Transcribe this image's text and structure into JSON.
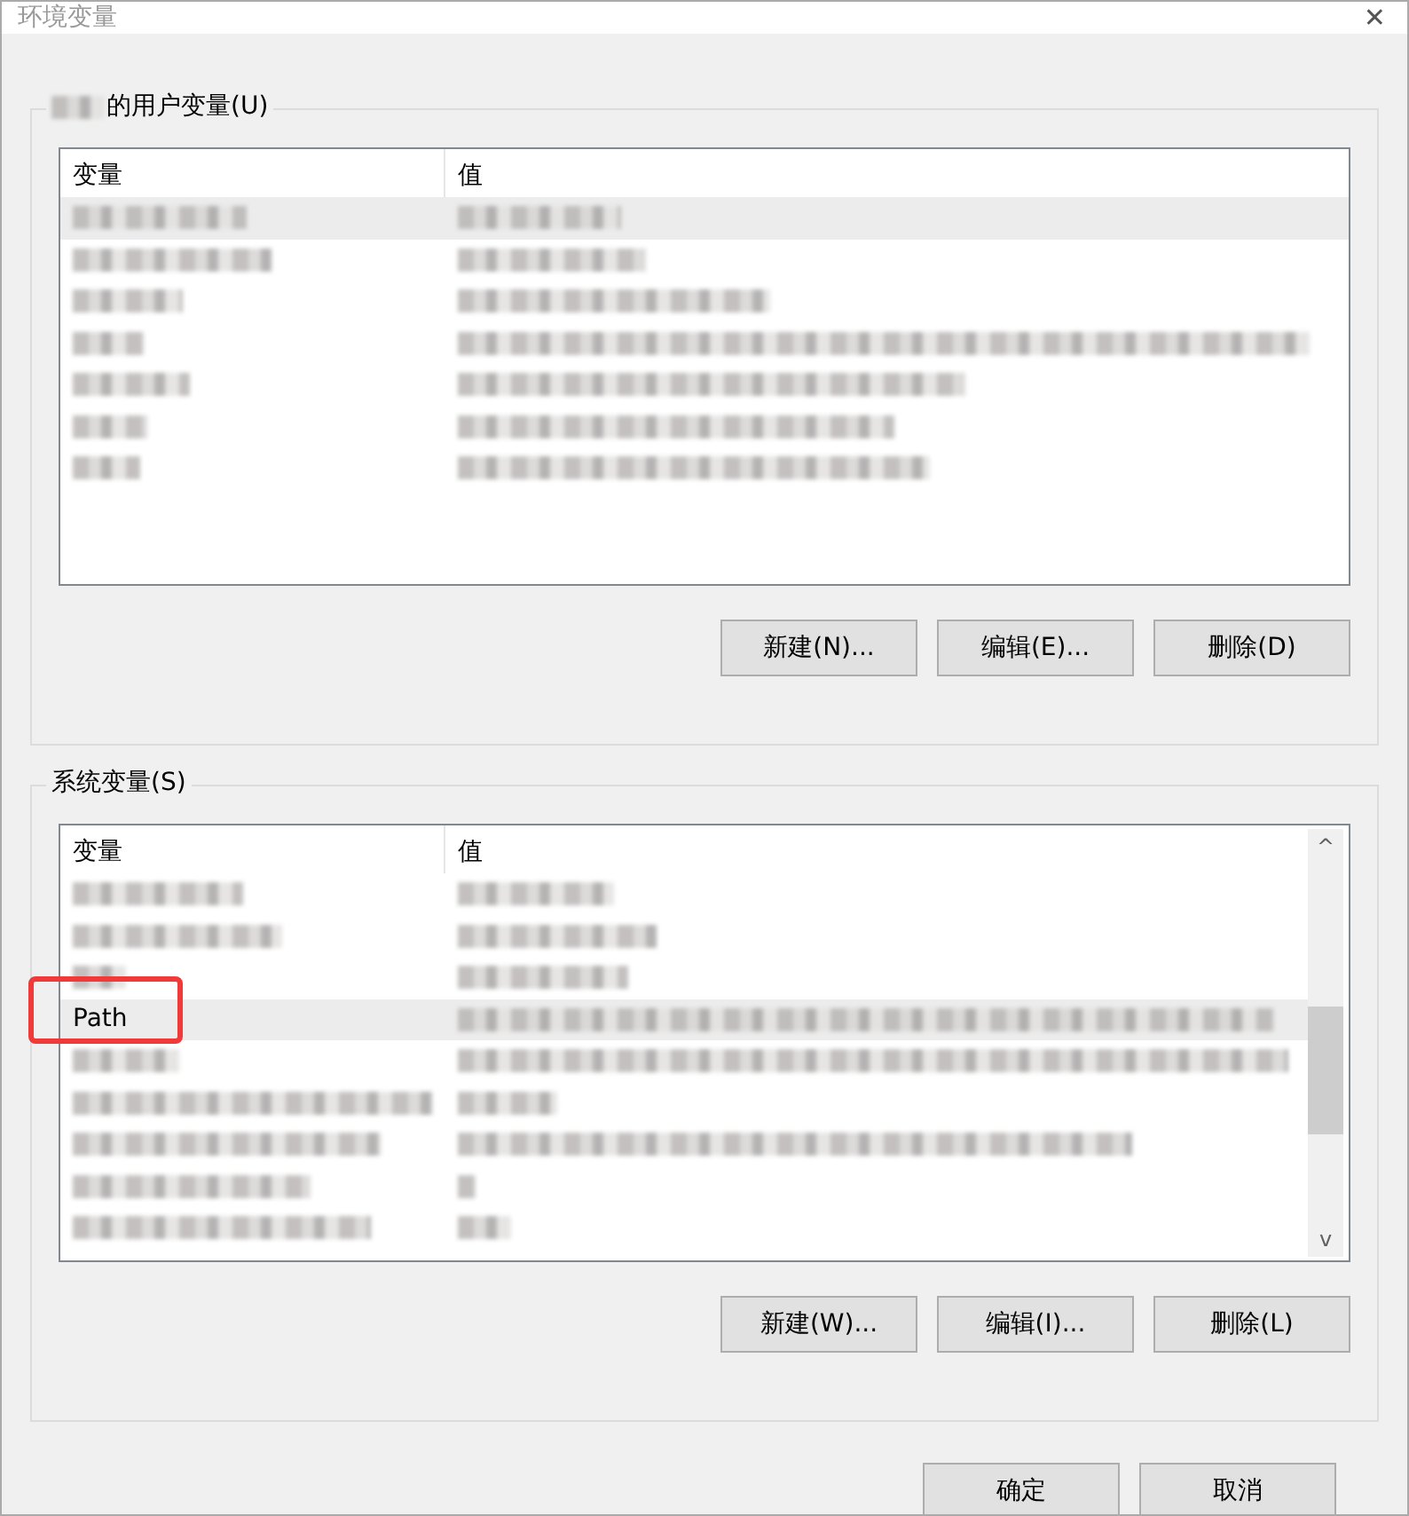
{
  "window": {
    "title": "环境变量",
    "close": "✕"
  },
  "user_group": {
    "label": "的用户变量(U)",
    "label_prefix_blurred": true,
    "columns": [
      "变量",
      "值"
    ],
    "rows": [
      {
        "selected": true
      },
      {
        "selected": false
      },
      {
        "selected": false
      },
      {
        "selected": false
      },
      {
        "selected": false
      },
      {
        "selected": false
      },
      {
        "selected": false
      }
    ],
    "buttons": [
      "新建(N)...",
      "编辑(E)...",
      "删除(D)"
    ]
  },
  "system_group": {
    "label": "系统变量(S)",
    "columns": [
      "变量",
      "值"
    ],
    "rows": [
      {
        "selected": false
      },
      {
        "selected": false
      },
      {
        "selected": false
      },
      {
        "name": "Path",
        "selected": true,
        "annotated": true
      },
      {
        "selected": false
      },
      {
        "selected": false
      },
      {
        "selected": false
      },
      {
        "selected": false
      },
      {
        "selected": false
      }
    ],
    "scrollbar": {
      "up": "^",
      "down": "v"
    },
    "buttons": [
      "新建(W)...",
      "编辑(I)...",
      "删除(L)"
    ]
  },
  "buttons": [
    "确定",
    "取消"
  ]
}
